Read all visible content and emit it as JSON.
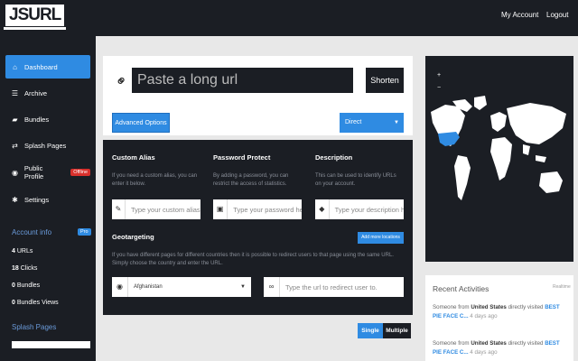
{
  "header": {
    "logo": "JSURL",
    "my_account": "My Account",
    "logout": "Logout"
  },
  "sidebar": {
    "items": [
      {
        "label": "Dashboard",
        "icon": "home-icon"
      },
      {
        "label": "Archive",
        "icon": "list-icon"
      },
      {
        "label": "Bundles",
        "icon": "folder-icon"
      },
      {
        "label": "Splash Pages",
        "icon": "swap-icon"
      },
      {
        "label": "Public Profile",
        "icon": "globe-icon",
        "badge": "Offline"
      },
      {
        "label": "Settings",
        "icon": "gear-icon"
      }
    ],
    "account_info": {
      "title": "Account info",
      "badge": "Pro",
      "stats": [
        {
          "value": "4",
          "label": "URLs"
        },
        {
          "value": "18",
          "label": "Clicks"
        },
        {
          "value": "0",
          "label": "Bundles"
        },
        {
          "value": "0",
          "label": "Bundles Views"
        }
      ]
    },
    "splash_title": "Splash Pages"
  },
  "shortener": {
    "url_placeholder": "Paste a long url",
    "shorten_label": "Shorten",
    "advanced_label": "Advanced Options",
    "redirect_type": "Direct"
  },
  "options": {
    "alias": {
      "title": "Custom Alias",
      "desc": "If you need a custom alias, you can enter it below.",
      "placeholder": "Type your custom alias here"
    },
    "password": {
      "title": "Password Protect",
      "desc": "By adding a password, you can restrict the access of statistics.",
      "placeholder": "Type your password here"
    },
    "description": {
      "title": "Description",
      "desc": "This can be used to identify URLs on your account.",
      "placeholder": "Type your description here"
    },
    "geo": {
      "title": "Geotargeting",
      "add_label": "Add more locations",
      "desc": "If you have different pages for different countries then it is possible to redirect users to that page using the same URL. Simply choose the country and enter the URL.",
      "country": "Afghanistan",
      "url_placeholder": "Type the url to redirect user to."
    }
  },
  "mode": {
    "single": "Single",
    "multiple": "Multiple"
  },
  "map": {
    "zoom_in": "+",
    "zoom_out": "−",
    "land_color": "#ffffff",
    "highlight_color": "#2f8be2"
  },
  "recent": {
    "title": "Recent Activities",
    "realtime": "Realtime",
    "items": [
      {
        "prefix": "Someone from",
        "country": "United States",
        "action": "directly visited",
        "link": "BEST PIE FACE C...",
        "ago": "4 days ago"
      },
      {
        "prefix": "Someone from",
        "country": "United States",
        "action": "directly visited",
        "link": "BEST PIE FACE C...",
        "ago": "4 days ago"
      }
    ]
  }
}
